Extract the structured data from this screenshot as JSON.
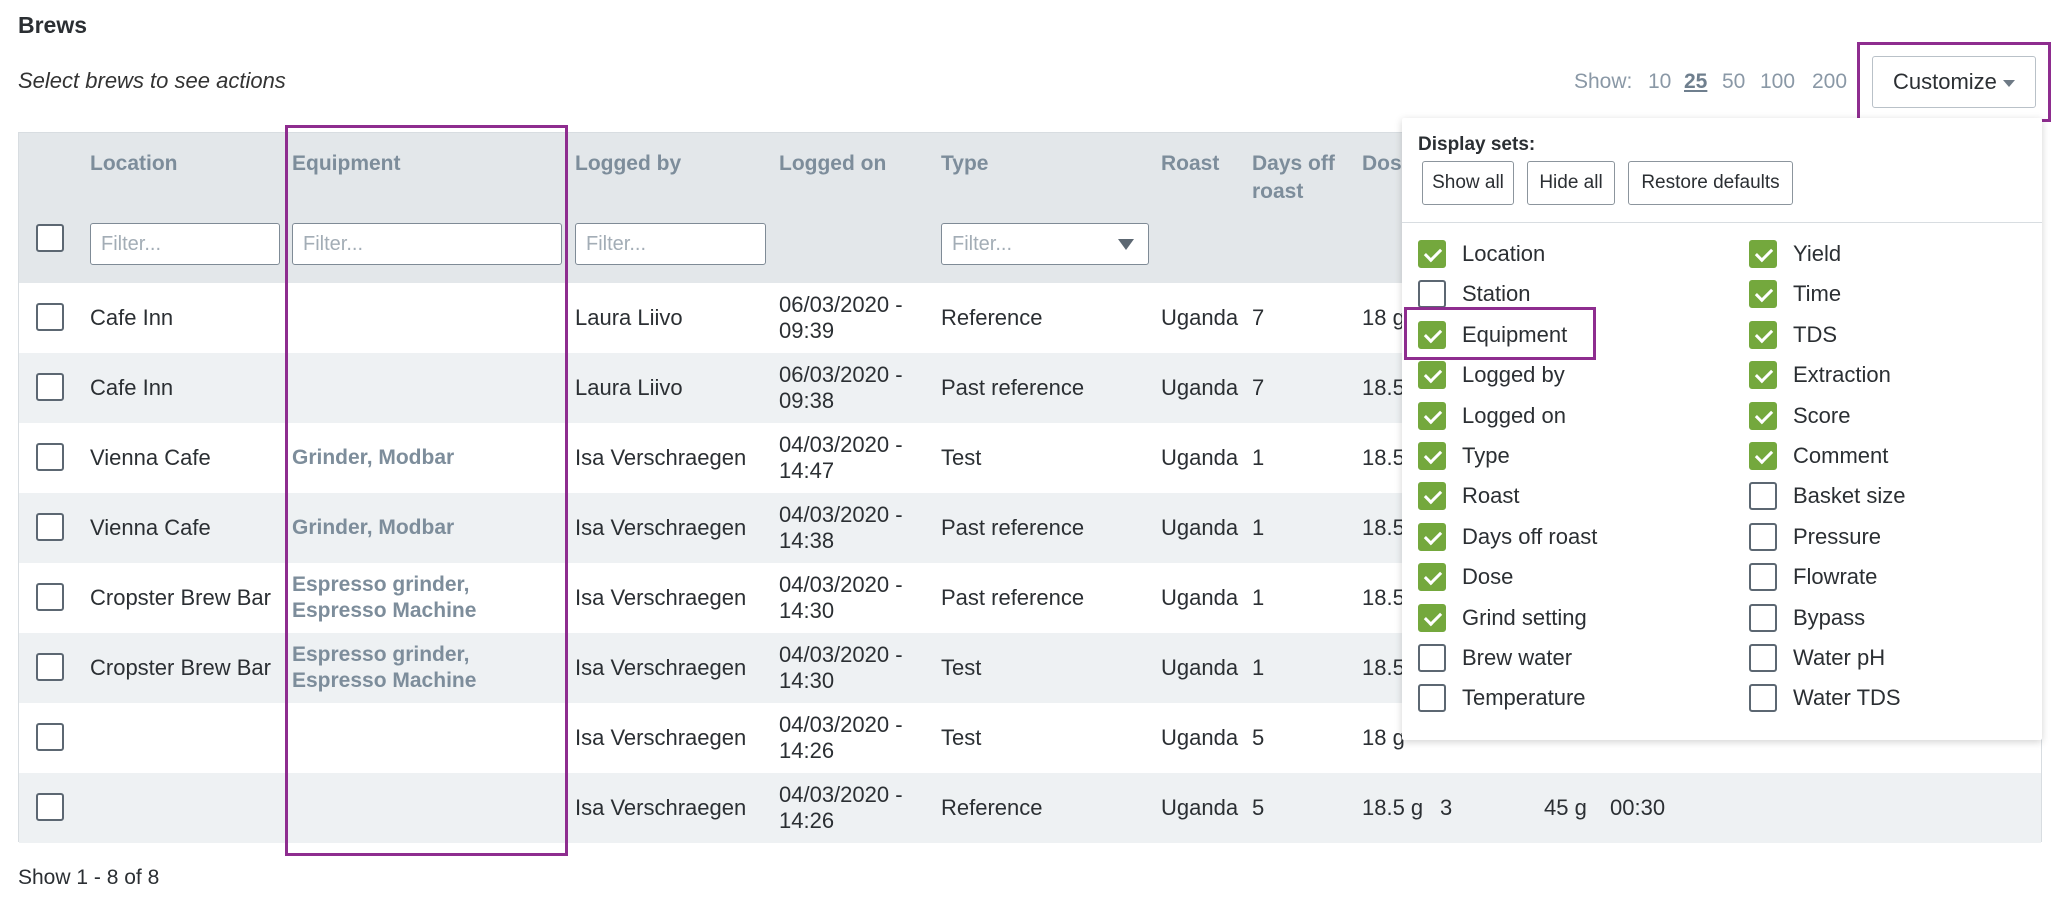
{
  "page": {
    "title": "Brews",
    "subtitle": "Select brews to see actions"
  },
  "pager": {
    "label": "Show:",
    "options": [
      "10",
      "25",
      "50",
      "100",
      "200"
    ],
    "selected": "25"
  },
  "customize": {
    "label": "Customize"
  },
  "table": {
    "headers": {
      "location": "Location",
      "equipment": "Equipment",
      "logged_by": "Logged by",
      "logged_on": "Logged on",
      "type": "Type",
      "roast": "Roast",
      "days_off_roast": "Days off roast",
      "dose": "Dos"
    },
    "filter_placeholder": "Filter...",
    "rows": [
      {
        "location": "Cafe Inn",
        "equipment": "",
        "logged_by": "Laura Liivo",
        "logged_on": "06/03/2020 - 09:39",
        "type": "Reference",
        "roast": "Uganda",
        "days": "7",
        "dose": "18 g",
        "extra1": "",
        "extra2": "",
        "extra3": ""
      },
      {
        "location": "Cafe Inn",
        "equipment": "",
        "logged_by": "Laura Liivo",
        "logged_on": "06/03/2020 - 09:38",
        "type": "Past reference",
        "roast": "Uganda",
        "days": "7",
        "dose": "18.5",
        "extra1": "",
        "extra2": "",
        "extra3": ""
      },
      {
        "location": "Vienna Cafe",
        "equipment": "Grinder, Modbar",
        "logged_by": "Isa Verschraegen",
        "logged_on": "04/03/2020 - 14:47",
        "type": "Test",
        "roast": "Uganda",
        "days": "1",
        "dose": "18.5",
        "extra1": "",
        "extra2": "",
        "extra3": ""
      },
      {
        "location": "Vienna Cafe",
        "equipment": "Grinder, Modbar",
        "logged_by": "Isa Verschraegen",
        "logged_on": "04/03/2020 - 14:38",
        "type": "Past reference",
        "roast": "Uganda",
        "days": "1",
        "dose": "18.5",
        "extra1": "",
        "extra2": "",
        "extra3": ""
      },
      {
        "location": "Cropster Brew Bar",
        "equipment": "Espresso grinder, Espresso Machine",
        "logged_by": "Isa Verschraegen",
        "logged_on": "04/03/2020 - 14:30",
        "type": "Past reference",
        "roast": "Uganda",
        "days": "1",
        "dose": "18.5",
        "extra1": "",
        "extra2": "",
        "extra3": ""
      },
      {
        "location": "Cropster Brew Bar",
        "equipment": "Espresso grinder, Espresso Machine",
        "logged_by": "Isa Verschraegen",
        "logged_on": "04/03/2020 - 14:30",
        "type": "Test",
        "roast": "Uganda",
        "days": "1",
        "dose": "18.5",
        "extra1": "",
        "extra2": "",
        "extra3": ""
      },
      {
        "location": "",
        "equipment": "",
        "logged_by": "Isa Verschraegen",
        "logged_on": "04/03/2020 - 14:26",
        "type": "Test",
        "roast": "Uganda",
        "days": "5",
        "dose": "18 g",
        "extra1": "",
        "extra2": "",
        "extra3": ""
      },
      {
        "location": "",
        "equipment": "",
        "logged_by": "Isa Verschraegen",
        "logged_on": "04/03/2020 - 14:26",
        "type": "Reference",
        "roast": "Uganda",
        "days": "5",
        "dose": "18.5 g",
        "extra1": "3",
        "extra2": "45 g",
        "extra3": "00:30"
      }
    ]
  },
  "footer": {
    "text": "Show 1 - 8 of 8"
  },
  "customize_panel": {
    "display_sets_label": "Display sets:",
    "buttons": {
      "show_all": "Show all",
      "hide_all": "Hide all",
      "restore": "Restore defaults"
    },
    "left_options": [
      {
        "label": "Location",
        "checked": true
      },
      {
        "label": "Station",
        "checked": false
      },
      {
        "label": "Equipment",
        "checked": true
      },
      {
        "label": "Logged by",
        "checked": true
      },
      {
        "label": "Logged on",
        "checked": true
      },
      {
        "label": "Type",
        "checked": true
      },
      {
        "label": "Roast",
        "checked": true
      },
      {
        "label": "Days off roast",
        "checked": true
      },
      {
        "label": "Dose",
        "checked": true
      },
      {
        "label": "Grind setting",
        "checked": true
      },
      {
        "label": "Brew water",
        "checked": false
      },
      {
        "label": "Temperature",
        "checked": false
      }
    ],
    "right_options": [
      {
        "label": "Yield",
        "checked": true
      },
      {
        "label": "Time",
        "checked": true
      },
      {
        "label": "TDS",
        "checked": true
      },
      {
        "label": "Extraction",
        "checked": true
      },
      {
        "label": "Score",
        "checked": true
      },
      {
        "label": "Comment",
        "checked": true
      },
      {
        "label": "Basket size",
        "checked": false
      },
      {
        "label": "Pressure",
        "checked": false
      },
      {
        "label": "Flowrate",
        "checked": false
      },
      {
        "label": "Bypass",
        "checked": false
      },
      {
        "label": "Water pH",
        "checked": false
      },
      {
        "label": "Water TDS",
        "checked": false
      }
    ]
  },
  "colors": {
    "accent_highlight": "#8e2d8f",
    "check_green": "#74a83d",
    "header_bg": "#e3e7ea",
    "muted_text": "#7d8d9b"
  }
}
